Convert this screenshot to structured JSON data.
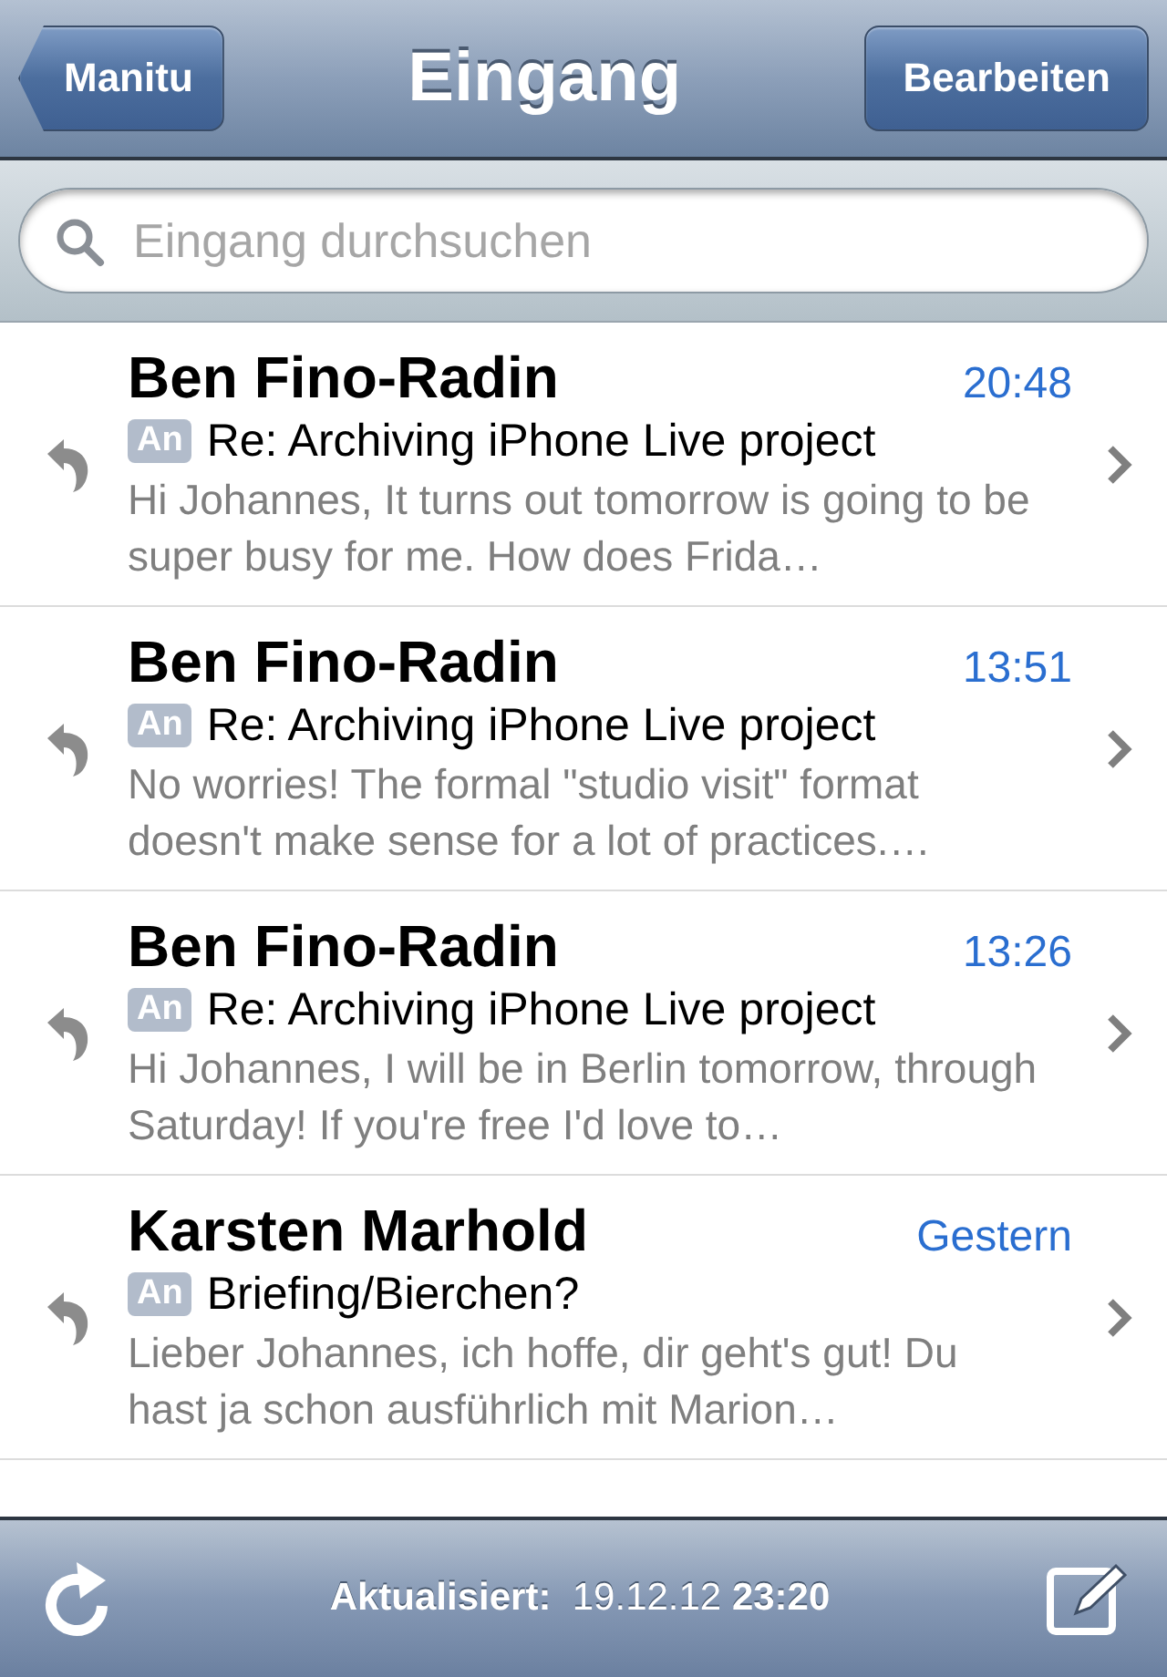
{
  "nav_bar": {
    "back_button": "Manitu",
    "title": "Eingang",
    "edit_button": "Bearbeiten"
  },
  "search": {
    "placeholder": "Eingang durchsuchen"
  },
  "messages": [
    {
      "sender": "Ben Fino-Radin",
      "time": "20:48",
      "badge": "An",
      "subject": "Re: Archiving iPhone Live project",
      "preview": "Hi Johannes, It turns out tomorrow is going to be super busy for me. How does Frida…",
      "replied": true
    },
    {
      "sender": "Ben Fino-Radin",
      "time": "13:51",
      "badge": "An",
      "subject": "Re: Archiving iPhone Live project",
      "preview": "No worries! The formal \"studio visit\" format doesn't make sense for a lot of practices.…",
      "replied": true
    },
    {
      "sender": "Ben Fino-Radin",
      "time": "13:26",
      "badge": "An",
      "subject": "Re: Archiving iPhone Live project",
      "preview": "Hi Johannes, I will be in Berlin tomorrow, through Saturday! If you're free I'd love to…",
      "replied": true
    },
    {
      "sender": "Karsten Marhold",
      "time": "Gestern",
      "badge": "An",
      "subject": "Briefing/Bierchen?",
      "preview": "Lieber Johannes, ich hoffe, dir geht's gut! Du hast ja schon ausführlich mit Marion…",
      "replied": true
    }
  ],
  "toolbar": {
    "status": "**Aktualisiert:**  19.12.12 **23:20**"
  }
}
